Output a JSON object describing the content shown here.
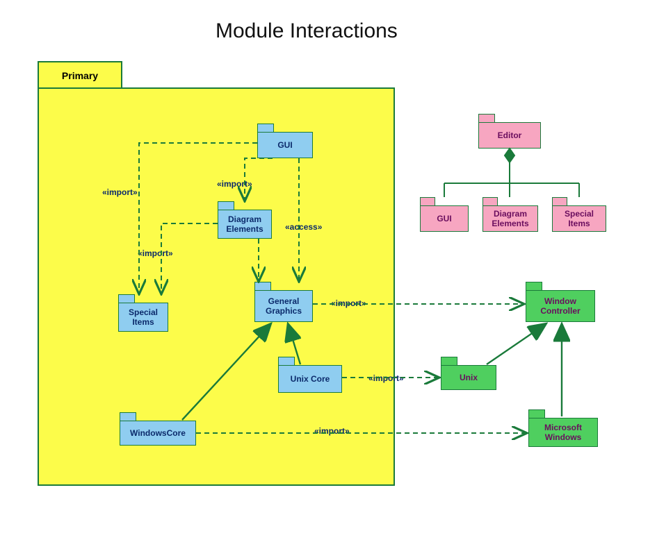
{
  "title": "Module Interactions",
  "primary_label": "Primary",
  "packages": {
    "gui": "GUI",
    "diagramElements": "Diagram Elements",
    "specialItems": "Special Items",
    "generalGraphics": "General Graphics",
    "unixCore": "Unix Core",
    "windowsCore": "WindowsCore",
    "editor": "Editor",
    "gui2": "GUI",
    "diagramElements2": "Diagram Elements",
    "specialItems2": "Special Items",
    "windowController": "Window Controller",
    "unix": "Unix",
    "msWindows": "Microsoft Windows"
  },
  "labels": {
    "import": "«import»",
    "access": "«access»"
  },
  "colors": {
    "blueFill": "#8fcdf0",
    "pinkFill": "#f7a6c1",
    "greenFill": "#4fcf5f",
    "outline": "#1a7a3a",
    "yellowFill": "#fcfc4a",
    "labelText": "#0b2a6b",
    "pinkText": "#6a0e5e"
  }
}
